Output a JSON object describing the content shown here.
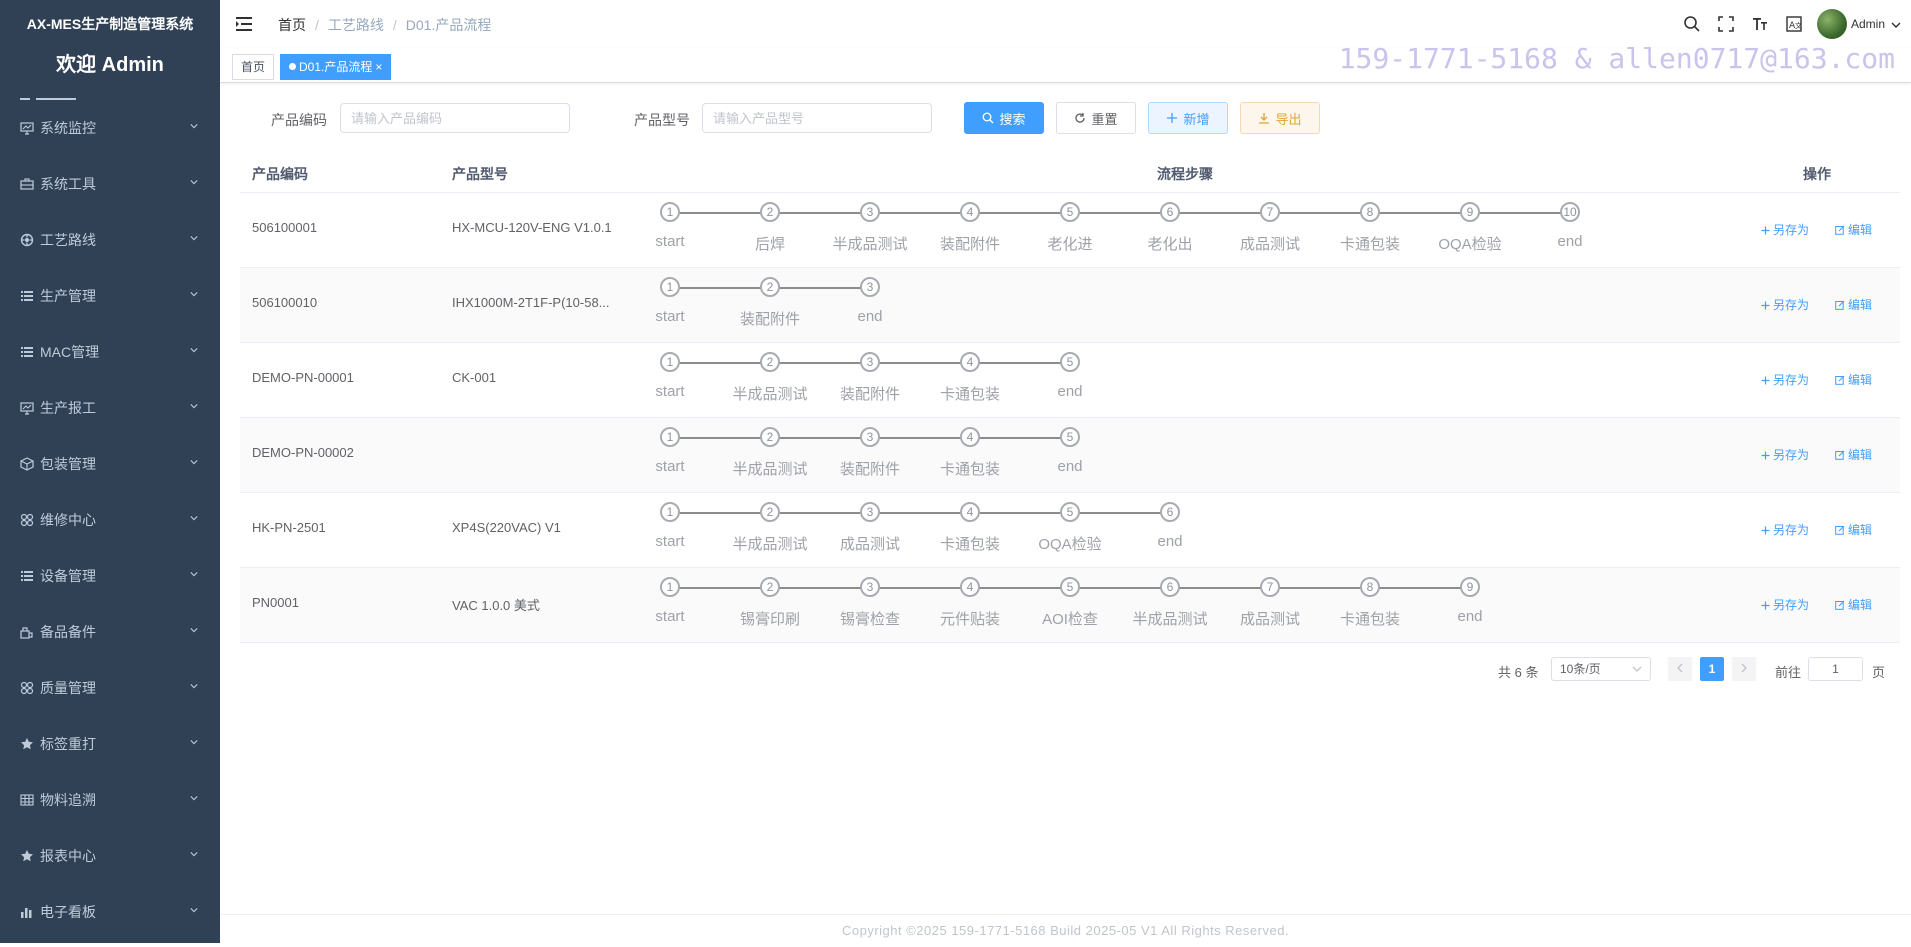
{
  "sidebar": {
    "system_title": "AX-MES生产制造管理系统",
    "welcome": "欢迎 Admin",
    "items": [
      {
        "label": "系统监控",
        "icon": "monitor-icon"
      },
      {
        "label": "系统工具",
        "icon": "toolbox-icon"
      },
      {
        "label": "工艺路线",
        "icon": "route-icon"
      },
      {
        "label": "生产管理",
        "icon": "list-icon"
      },
      {
        "label": "MAC管理",
        "icon": "list-icon"
      },
      {
        "label": "生产报工",
        "icon": "monitor-icon"
      },
      {
        "label": "包装管理",
        "icon": "package-icon"
      },
      {
        "label": "维修中心",
        "icon": "grid-icon"
      },
      {
        "label": "设备管理",
        "icon": "list-icon"
      },
      {
        "label": "备品备件",
        "icon": "lock-icon"
      },
      {
        "label": "质量管理",
        "icon": "grid-icon"
      },
      {
        "label": "标签重打",
        "icon": "star-icon"
      },
      {
        "label": "物料追溯",
        "icon": "table-icon"
      },
      {
        "label": "报表中心",
        "icon": "star-icon"
      },
      {
        "label": "电子看板",
        "icon": "chart-icon"
      }
    ]
  },
  "navbar": {
    "breadcrumb": [
      "首页",
      "工艺路线",
      "D01.产品流程"
    ],
    "user": "Admin"
  },
  "tags": {
    "home": "首页",
    "active": "D01.产品流程"
  },
  "watermark": "159-1771-5168 & allen0717@163.com",
  "search": {
    "code_label": "产品编码",
    "code_placeholder": "请输入产品编码",
    "model_label": "产品型号",
    "model_placeholder": "请输入产品型号",
    "search_btn": "搜索",
    "reset_btn": "重置",
    "add_btn": "新增",
    "export_btn": "导出"
  },
  "table": {
    "headers": {
      "code": "产品编码",
      "model": "产品型号",
      "steps": "流程步骤",
      "ops": "操作"
    },
    "op_save_as": "另存为",
    "op_edit": "编辑",
    "rows": [
      {
        "code": "506100001",
        "model": "HX-MCU-120V-ENG V1.0.1",
        "steps": [
          "start",
          "后焊",
          "半成品测试",
          "装配附件",
          "老化进",
          "老化出",
          "成品测试",
          "卡通包装",
          "OQA检验",
          "end"
        ]
      },
      {
        "code": "506100010",
        "model": "IHX1000M-2T1F-P(10-58...",
        "steps": [
          "start",
          "装配附件",
          "end"
        ]
      },
      {
        "code": "DEMO-PN-00001",
        "model": "CK-001",
        "steps": [
          "start",
          "半成品测试",
          "装配附件",
          "卡通包装",
          "end"
        ]
      },
      {
        "code": "DEMO-PN-00002",
        "model": "",
        "steps": [
          "start",
          "半成品测试",
          "装配附件",
          "卡通包装",
          "end"
        ]
      },
      {
        "code": "HK-PN-2501",
        "model": "XP4S(220VAC) V1",
        "steps": [
          "start",
          "半成品测试",
          "成品测试",
          "卡通包装",
          "OQA检验",
          "end"
        ]
      },
      {
        "code": "PN0001",
        "model": "VAC 1.0.0 美式",
        "steps": [
          "start",
          "锡膏印刷",
          "锡膏检查",
          "元件贴装",
          "AOI检查",
          "半成品测试",
          "成品测试",
          "卡通包装",
          "end"
        ]
      }
    ]
  },
  "pagination": {
    "total": "共 6 条",
    "page_size": "10条/页",
    "current": "1",
    "goto_label": "前往",
    "goto_value": "1",
    "page_suffix": "页"
  },
  "footer": "Copyright ©2025 159-1771-5168 Build 2025-05 V1 All Rights Reserved."
}
